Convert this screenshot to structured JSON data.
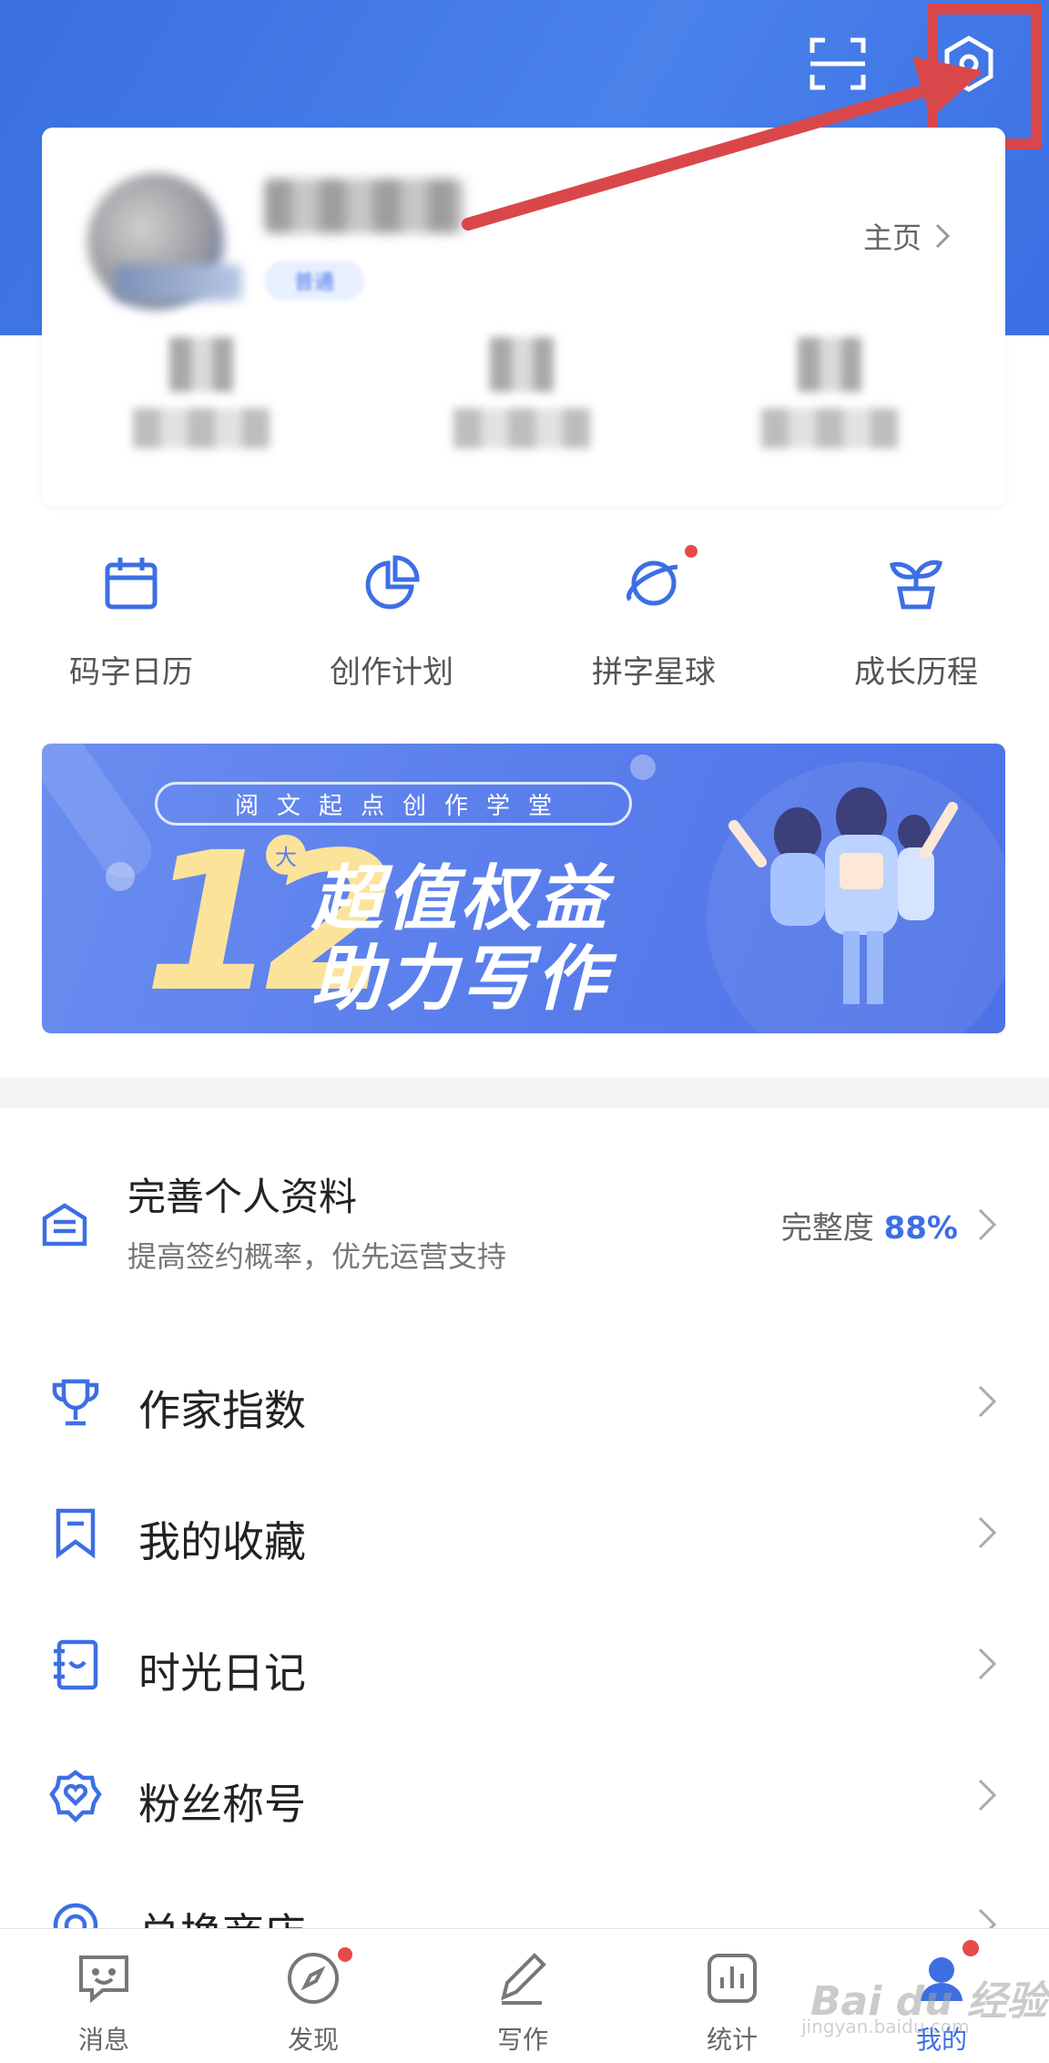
{
  "profile": {
    "homepage_label": "主页",
    "tag_label": "普通"
  },
  "quick_actions": [
    {
      "label": "码字日历",
      "icon": "calendar-icon"
    },
    {
      "label": "创作计划",
      "icon": "pie-chart-icon"
    },
    {
      "label": "拼字星球",
      "icon": "planet-icon",
      "badge": true
    },
    {
      "label": "成长历程",
      "icon": "sprout-icon"
    }
  ],
  "banner": {
    "pill": "阅文起点创作学堂",
    "number": "12",
    "badge": "大",
    "line1": "超值权益",
    "line2": "助力写作"
  },
  "profile_completion": {
    "title": "完善个人资料",
    "subtitle": "提高签约概率，优先运营支持",
    "completeness_label": "完整度",
    "completeness_value": "88%"
  },
  "menu": [
    {
      "label": "作家指数",
      "icon": "trophy-icon"
    },
    {
      "label": "我的收藏",
      "icon": "bookmark-icon"
    },
    {
      "label": "时光日记",
      "icon": "diary-icon"
    },
    {
      "label": "粉丝称号",
      "icon": "fan-badge-icon"
    },
    {
      "label": "兑换商店",
      "icon": "store-icon"
    }
  ],
  "bottom_nav": [
    {
      "label": "消息",
      "icon": "message-icon"
    },
    {
      "label": "发现",
      "icon": "compass-icon",
      "badge": true
    },
    {
      "label": "写作",
      "icon": "pen-icon"
    },
    {
      "label": "统计",
      "icon": "stats-icon"
    },
    {
      "label": "我的",
      "icon": "profile-icon",
      "active": true,
      "badge": true
    }
  ],
  "watermark": {
    "text": "Bai du 经验",
    "sub": "jingyan.baidu.com"
  },
  "colors": {
    "accent": "#3d6fe3",
    "header": "#4a82ea",
    "highlight": "#d9474a",
    "badge": "#e84a48"
  }
}
